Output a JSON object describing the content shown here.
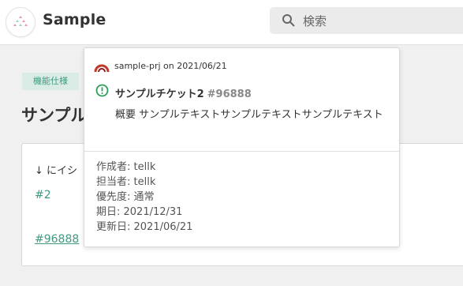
{
  "header": {
    "title": "Sample",
    "search_placeholder": "検索"
  },
  "issue": {
    "tag": "機能仕様",
    "title_visible": "サンプル",
    "content_text": "↓ にイシ",
    "link_1": "#2",
    "link_2": "#96888"
  },
  "popup": {
    "project_line": "sample-prj on 2021/06/21",
    "ticket_title": "サンプルチケット2",
    "ticket_key": "#96888",
    "summary": "概要 サンプルテキストサンプルテキストサンプルテキスト",
    "meta": [
      "作成者: tellk",
      "担当者: tellk",
      "優先度: 通常",
      "期日: 2021/12/31",
      "更新日: 2021/06/21"
    ]
  },
  "colors": {
    "accent": "#3f9a80",
    "tag_bg": "#d9ece6",
    "status_green": "#2e9d57",
    "project_icon_red": "#c0392b"
  },
  "icons": {
    "logo": "sample-logo-icon",
    "search": "search-icon",
    "project": "project-arch-icon",
    "status": "exclamation-circle-icon"
  }
}
